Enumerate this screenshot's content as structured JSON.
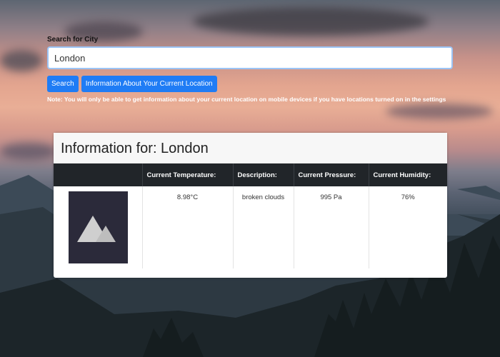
{
  "search": {
    "label": "Search for City",
    "value": "London",
    "search_button": "Search",
    "location_button": "Information About Your Current Location",
    "note": "Note: You will only be able to get information about your current location on mobile devices if you have locations turned on in the settings"
  },
  "weather": {
    "title": "Information for: London",
    "columns": [
      "",
      "Current Temperature:",
      "Description:",
      "Current Pressure:",
      "Current Humidity:"
    ],
    "row": {
      "image_icon": "image-placeholder-icon",
      "temperature": "8.98°C",
      "description": "broken clouds",
      "pressure": "995 Pa",
      "humidity": "76%"
    }
  }
}
